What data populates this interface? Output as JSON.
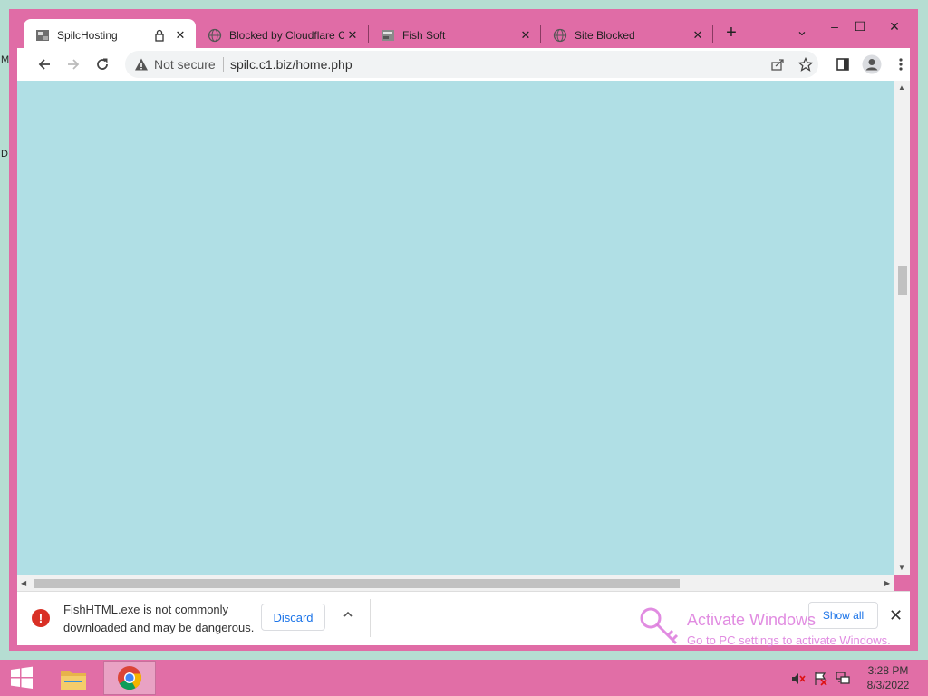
{
  "desktop": {
    "edge_text_1": "M",
    "edge_text_2": "D"
  },
  "window_controls": {
    "minimize": "–",
    "maximize": "☐",
    "close": "✕"
  },
  "tabs": [
    {
      "title": "SpilcHosting",
      "close": "✕",
      "icon": "page-thumbnail-icon",
      "active": true
    },
    {
      "title": "Blocked by Cloudflare C",
      "close": "✕",
      "icon": "globe-icon"
    },
    {
      "title": "Fish Soft",
      "close": "✕",
      "icon": "page-thumbnail-icon"
    },
    {
      "title": "Site Blocked",
      "close": "✕",
      "icon": "globe-icon"
    }
  ],
  "new_tab": "+",
  "tab_search": "⌄",
  "toolbar": {
    "security_label": "Not secure",
    "url": "spilc.c1.biz/home.php"
  },
  "download_bar": {
    "message": "FishHTML.exe is not commonly downloaded and may be dangerous.",
    "discard_label": "Discard",
    "show_all_label": "Show all",
    "close": "✕",
    "warning_glyph": "!"
  },
  "watermark": {
    "line1": "Activate Windows",
    "line2": "Go to PC settings to activate Windows."
  },
  "taskbar": {
    "time": "3:28 PM",
    "date": "8/3/2022"
  },
  "colors": {
    "window_frame": "#e06ca6",
    "page_background": "#b0dfe5",
    "taskbar": "#e16ea6",
    "desktop": "#b5ddd2",
    "accent_blue": "#1a73e8",
    "danger": "#d93025"
  }
}
